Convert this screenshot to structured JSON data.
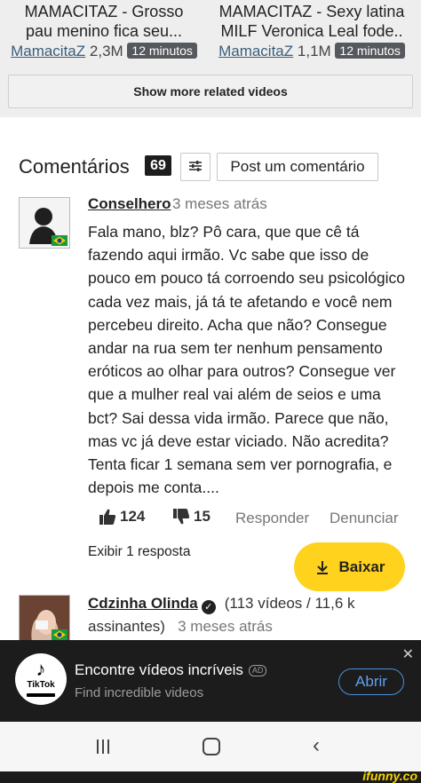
{
  "related_videos": [
    {
      "title_line1": "MAMACITAZ - Grosso",
      "title_line2": "pau menino fica seu...",
      "author": "MamacitaZ",
      "views": "2,3M",
      "duration": "12 minutos"
    },
    {
      "title_line1": "MAMACITAZ - Sexy latina",
      "title_line2": "MILF Veronica Leal fode..",
      "author": "MamacitaZ",
      "views": "1,1M",
      "duration": "12 minutos"
    }
  ],
  "show_more_label": "Show more related videos",
  "comments_section": {
    "title": "Comentários",
    "count": "69",
    "filter_icon": "sliders-icon",
    "post_label": "Post um comentário"
  },
  "comment1": {
    "user": "Conselhero",
    "time": "3 meses atrás",
    "text": "Fala mano, blz? Pô cara, que que cê tá fazendo aqui irmão. Vc sabe que isso de pouco em pouco tá corroendo seu psicológico cada vez mais, já tá te afetando e você nem percebeu direito. Acha que não? Consegue andar na rua sem ter nenhum pensamento eróticos ao olhar para outros? Consegue ver que a mulher real vai além de seios e uma bct? Sai dessa vida irmão. Parece que não, mas vc já deve estar viciado. Não acredita? Tenta ficar 1 semana sem ver pornografia, e depois me conta....",
    "likes": "124",
    "dislikes": "15",
    "reply_label": "Responder",
    "report_label": "Denunciar",
    "show_replies": "Exibir 1 resposta"
  },
  "download_label": "Baixar",
  "comment2": {
    "user": "Cdzinha Olinda",
    "subscription_info": "(113 vídeos / 11,6 k",
    "subscription_info_2": "assinantes)",
    "time": "3 meses atrás"
  },
  "ad": {
    "brand": "TikTok",
    "title": "Encontre vídeos incríveis",
    "badge": "AD",
    "subtitle": "Find incredible videos",
    "cta": "Abrir"
  },
  "watermark": "ifunny.co",
  "colors": {
    "download_yellow": "#ffd21e",
    "ad_background": "#1c1c1c",
    "cta_blue": "#5fa0ee",
    "link_blue": "#3b5d7c"
  }
}
